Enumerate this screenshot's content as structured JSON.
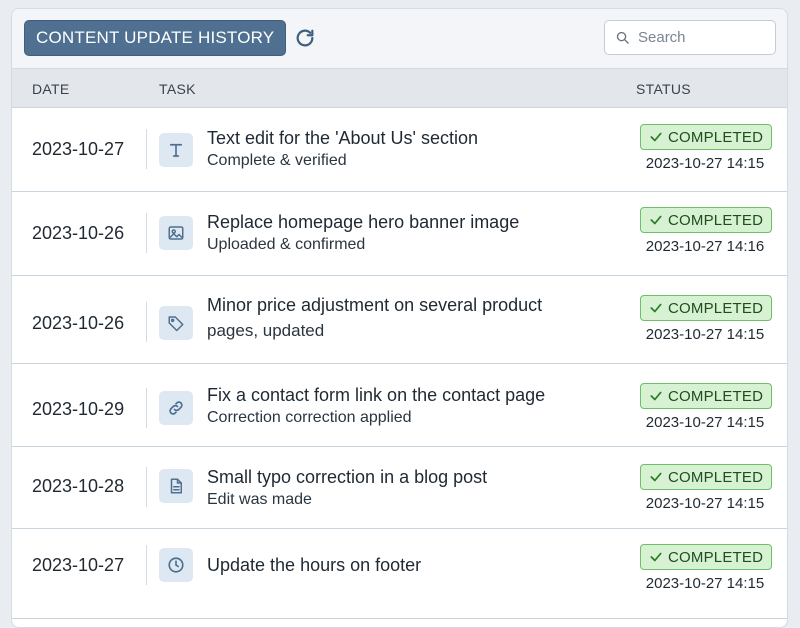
{
  "toolbar": {
    "title": "CONTENT UPDATE HISTORY",
    "search_placeholder": "Search",
    "icons": {
      "refresh": "refresh-icon",
      "search": "search-icon"
    }
  },
  "columns": {
    "date": "DATE",
    "task": "TASK",
    "status": "STATUS"
  },
  "colors": {
    "title_bg": "#4f7090",
    "badge_bg": "#d6f2d2",
    "badge_border": "#6fbf6a",
    "icon_bg": "#dde8f3"
  },
  "rows": [
    {
      "date": "2023-10-27",
      "icon": "text-icon",
      "title": "Text edit for the 'About Us' section",
      "subtitle": "Complete & verified",
      "status": "COMPLETED",
      "status_time": "2023-10-27 14:15"
    },
    {
      "date": "2023-10-26",
      "icon": "image-icon",
      "title": "Replace homepage hero banner image",
      "subtitle": "Uploaded & confirmed",
      "status": "COMPLETED",
      "status_time": "2023-10-27 14:16"
    },
    {
      "date": "2023-10-26",
      "icon": "tag-icon",
      "title": "Minor price adjustment on several product",
      "subtitle": "pages, updated",
      "status": "COMPLETED",
      "status_time": "2023-10-27 14:15"
    },
    {
      "date": "2023-10-29",
      "icon": "link-icon",
      "title": "Fix a contact form link on the contact page",
      "subtitle": "Correction correction applied",
      "status": "COMPLETED",
      "status_time": "2023-10-27 14:15"
    },
    {
      "date": "2023-10-28",
      "icon": "document-icon",
      "title": "Small typo correction in a blog post",
      "subtitle": "Edit was made",
      "status": "COMPLETED",
      "status_time": "2023-10-27 14:15"
    },
    {
      "date": "2023-10-27",
      "icon": "clock-icon",
      "title": "Update the hours on footer",
      "subtitle": "",
      "status": "COMPLETED",
      "status_time": "2023-10-27 14:15"
    }
  ]
}
